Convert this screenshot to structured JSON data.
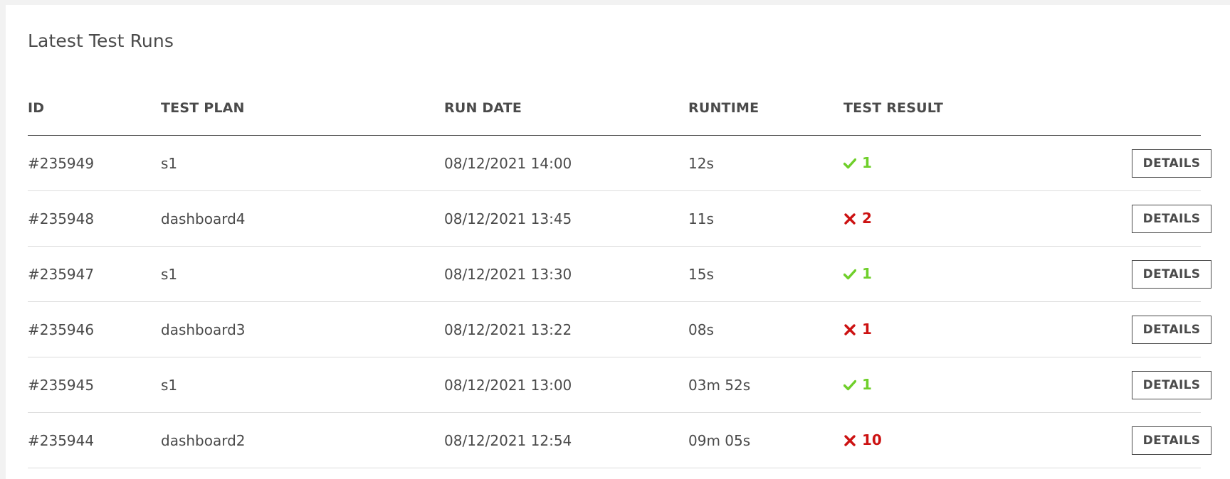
{
  "card": {
    "title": "Latest Test Runs"
  },
  "table": {
    "headers": {
      "id": "ID",
      "plan": "TEST PLAN",
      "date": "RUN DATE",
      "runtime": "RUNTIME",
      "result": "TEST RESULT"
    },
    "rows": [
      {
        "id": "#235949",
        "plan": "s1",
        "date": "08/12/2021 14:00",
        "runtime": "12s",
        "status": "pass",
        "status_icon": "check-icon",
        "count": "1",
        "action": "DETAILS"
      },
      {
        "id": "#235948",
        "plan": "dashboard4",
        "date": "08/12/2021 13:45",
        "runtime": "11s",
        "status": "fail",
        "status_icon": "cross-icon",
        "count": "2",
        "action": "DETAILS"
      },
      {
        "id": "#235947",
        "plan": "s1",
        "date": "08/12/2021 13:30",
        "runtime": "15s",
        "status": "pass",
        "status_icon": "check-icon",
        "count": "1",
        "action": "DETAILS"
      },
      {
        "id": "#235946",
        "plan": "dashboard3",
        "date": "08/12/2021 13:22",
        "runtime": "08s",
        "status": "fail",
        "status_icon": "cross-icon",
        "count": "1",
        "action": "DETAILS"
      },
      {
        "id": "#235945",
        "plan": "s1",
        "date": "08/12/2021 13:00",
        "runtime": "03m 52s",
        "status": "pass",
        "status_icon": "check-icon",
        "count": "1",
        "action": "DETAILS"
      },
      {
        "id": "#235944",
        "plan": "dashboard2",
        "date": "08/12/2021 12:54",
        "runtime": "09m 05s",
        "status": "fail",
        "status_icon": "cross-icon",
        "count": "10",
        "action": "DETAILS"
      }
    ]
  },
  "colors": {
    "pass": "#6fcf2a",
    "fail": "#cc1111",
    "text": "#4a4a4a",
    "divider": "#dcdcdc"
  }
}
